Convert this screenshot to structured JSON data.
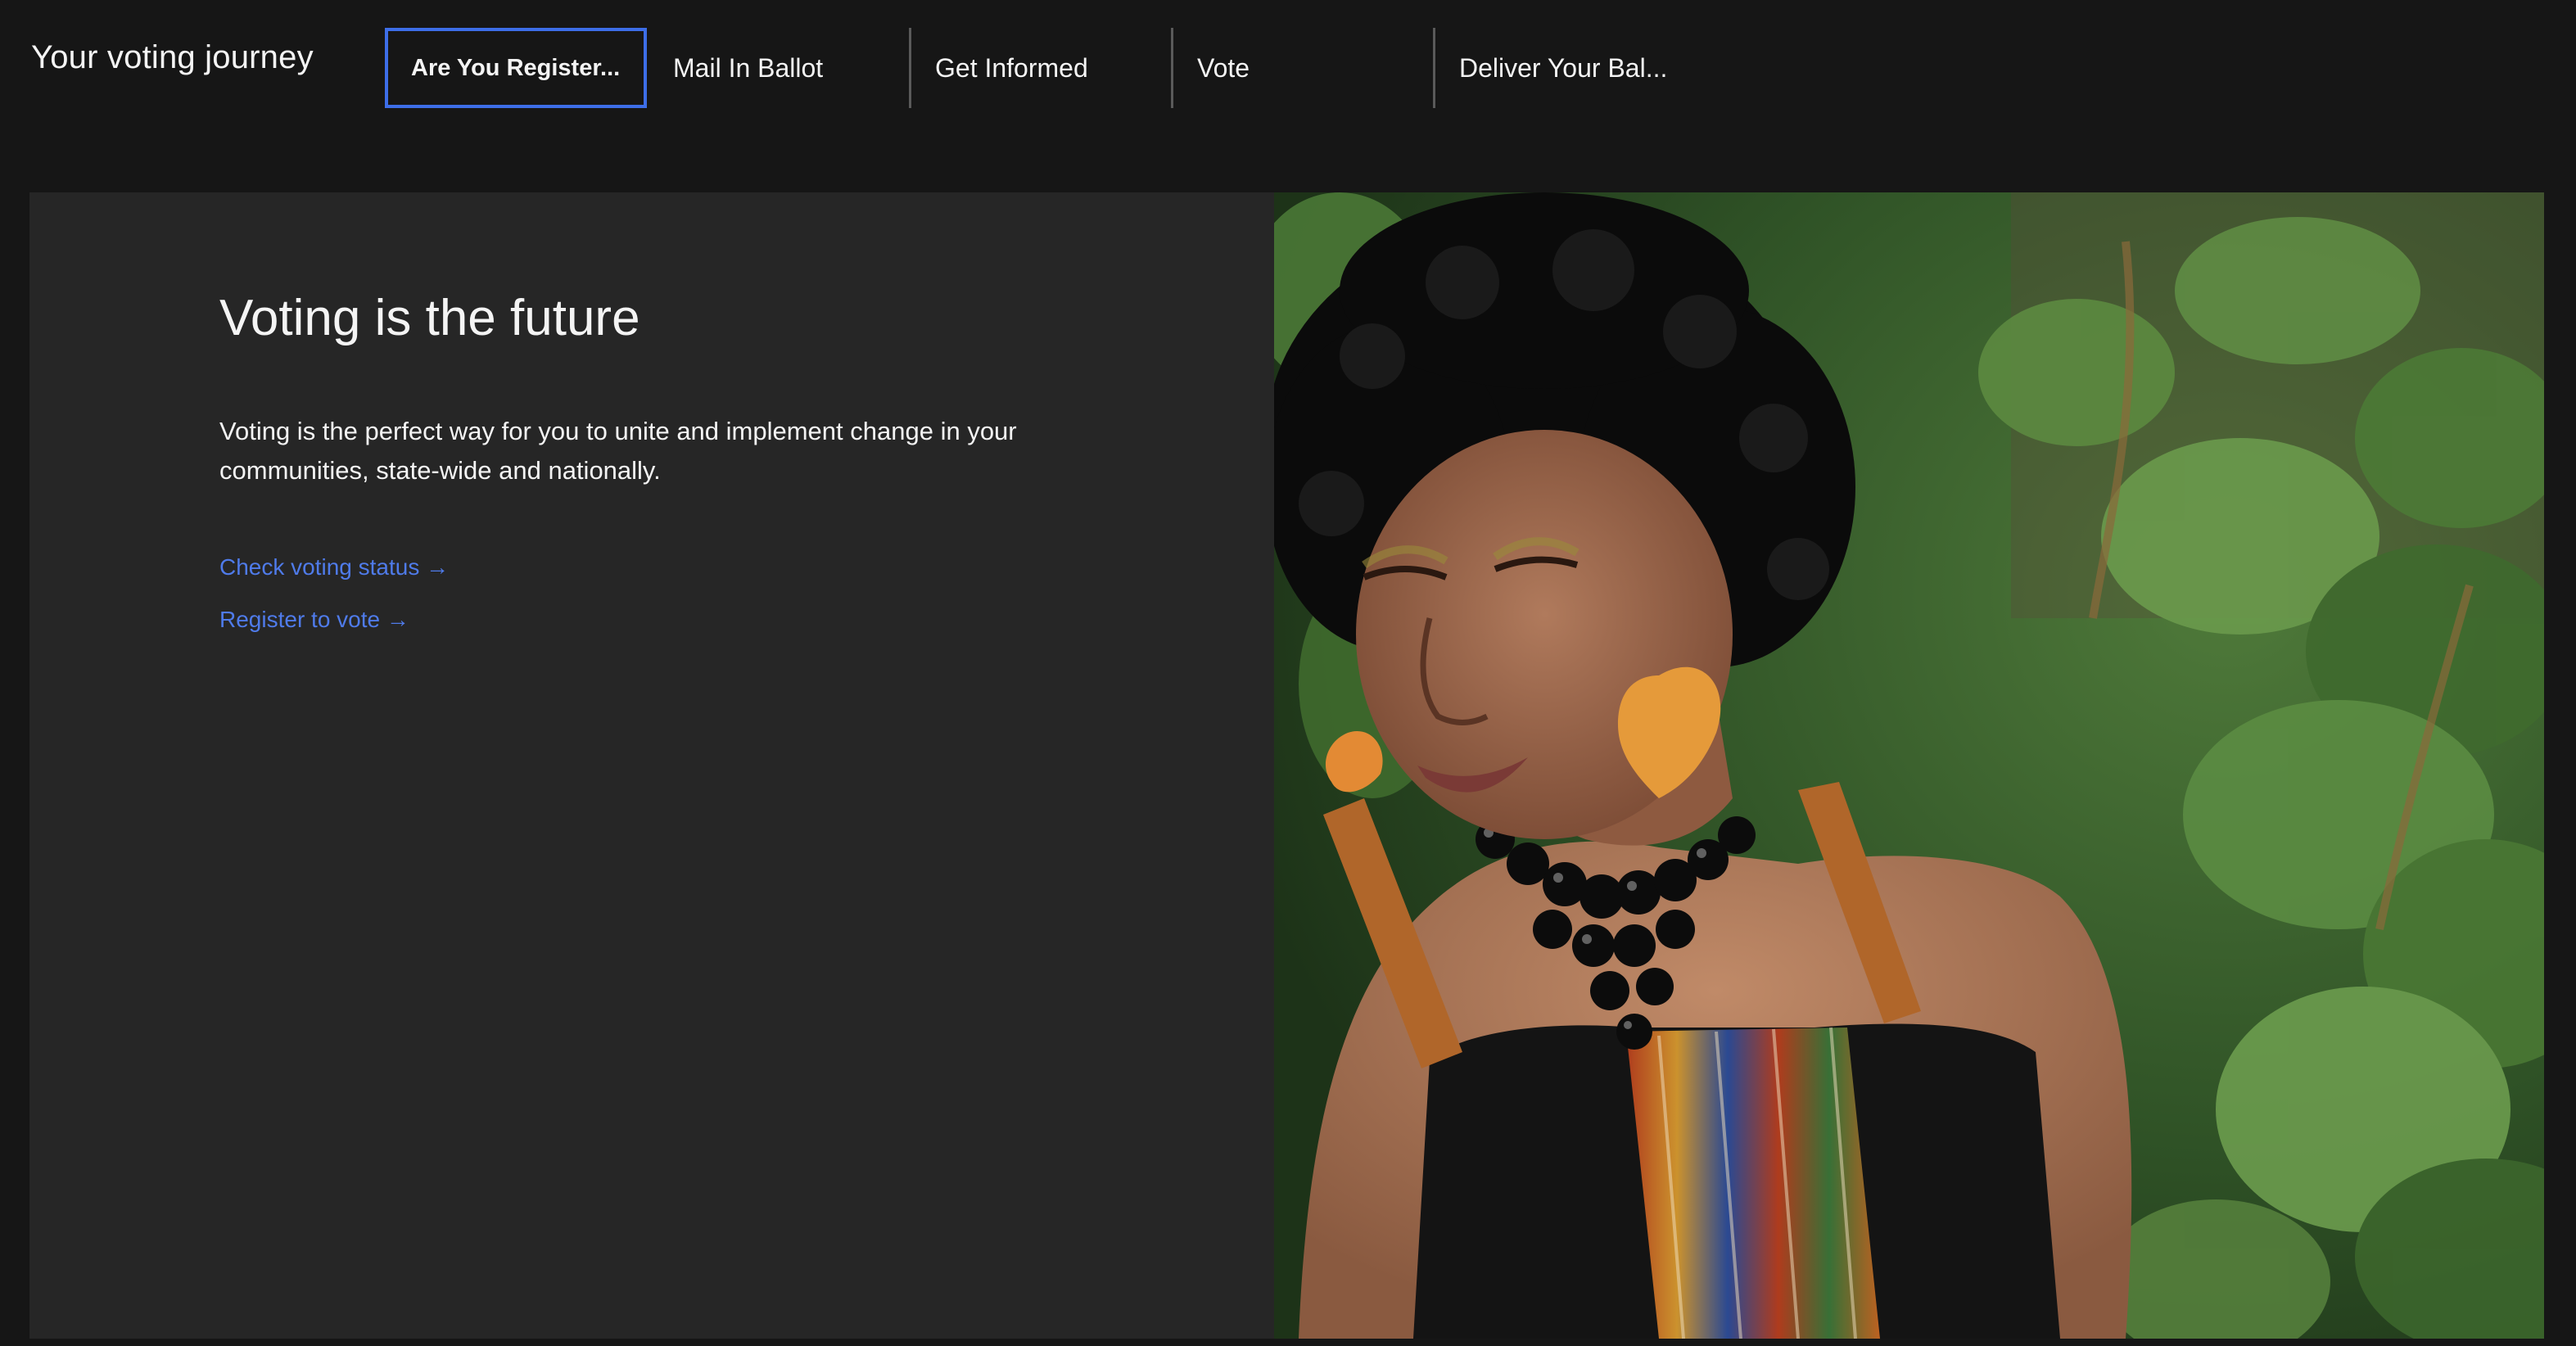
{
  "header": {
    "title": "Your voting journey",
    "tabs": [
      {
        "label": "Are You Register...",
        "selected": true
      },
      {
        "label": "Mail In Ballot",
        "selected": false
      },
      {
        "label": "Get Informed",
        "selected": false
      },
      {
        "label": "Vote",
        "selected": false
      },
      {
        "label": "Deliver Your Bal...",
        "selected": false
      }
    ]
  },
  "main": {
    "headline": "Voting is the future",
    "body": "Voting is the perfect way for you to unite and implement change in your communities, state-wide and nationally.",
    "links": [
      {
        "label": "Check voting status →"
      },
      {
        "label": "Register to vote →"
      }
    ]
  },
  "colors": {
    "background": "#161616",
    "panel": "#262626",
    "accent": "#3d6ee8",
    "link": "#4f7bea",
    "text": "#f4f4f4"
  },
  "image": {
    "subject": "woman-with-afro-and-orange-earrings-among-green-leaves"
  }
}
